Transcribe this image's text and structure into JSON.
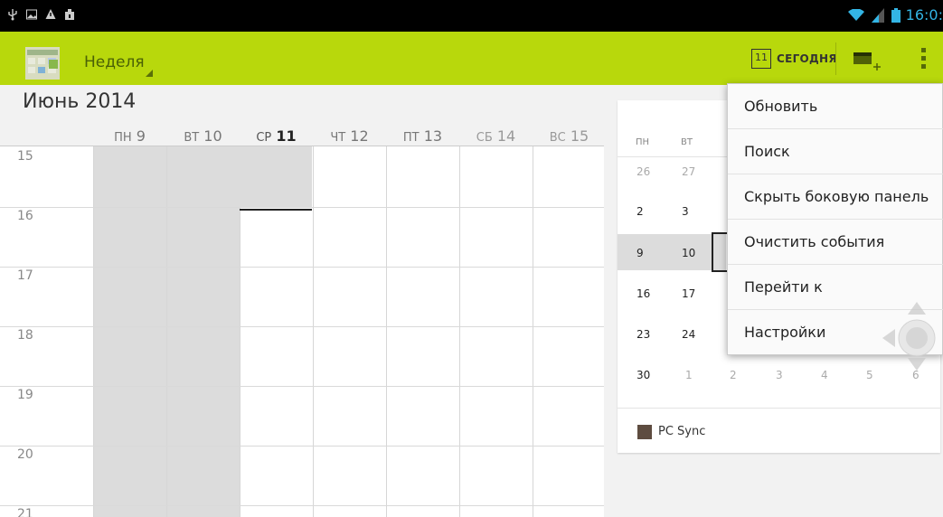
{
  "statusbar": {
    "time": "16:0:"
  },
  "actionbar": {
    "view_label": "Неделя",
    "today_icon_num": "11",
    "today_label": "СЕГОДНЯ",
    "accent_color": "#b8d80c"
  },
  "month_title": "Июнь 2014",
  "week": {
    "days": [
      {
        "dow": "ПН",
        "num": "9"
      },
      {
        "dow": "ВТ",
        "num": "10"
      },
      {
        "dow": "СР",
        "num": "11"
      },
      {
        "dow": "ЧТ",
        "num": "12"
      },
      {
        "dow": "ПТ",
        "num": "13"
      },
      {
        "dow": "СБ",
        "num": "14"
      },
      {
        "dow": "ВС",
        "num": "15"
      }
    ],
    "hours": [
      "15",
      "16",
      "17",
      "18",
      "19",
      "20",
      "21"
    ]
  },
  "minimonth": {
    "dows": [
      "ПН",
      "ВТ"
    ],
    "weeks": [
      [
        "26",
        "27"
      ],
      [
        "2",
        "3"
      ],
      [
        "9",
        "10"
      ],
      [
        "16",
        "17"
      ],
      [
        "23",
        "24"
      ],
      [
        "30",
        "1",
        "2",
        "3",
        "4",
        "5",
        "6"
      ]
    ],
    "calendar_name": "PC Sync",
    "calendar_color": "#5e4c40"
  },
  "menu": {
    "items": [
      "Обновить",
      "Поиск",
      "Скрыть боковую панель",
      "Очистить события",
      "Перейти к",
      "Настройки"
    ]
  }
}
